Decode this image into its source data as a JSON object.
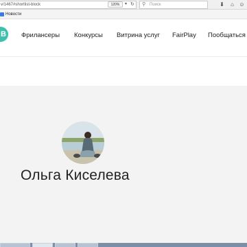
{
  "browser": {
    "url": "v/1467#shortlist-block",
    "zoom": "120%",
    "search_placeholder": "Поиск",
    "bookmarks": [
      {
        "label": "Новости"
      }
    ]
  },
  "site": {
    "logo_text": "B",
    "nav": [
      {
        "label": "Фрилансеры"
      },
      {
        "label": "Конкурсы"
      },
      {
        "label": "Витрина услуг"
      },
      {
        "label": "FairPlay"
      },
      {
        "label": "Пообщаться"
      }
    ]
  },
  "profile": {
    "name": "Ольга Киселева"
  },
  "colors": {
    "brand": "#3fbfae",
    "profile_background": "#f3f3f3"
  }
}
